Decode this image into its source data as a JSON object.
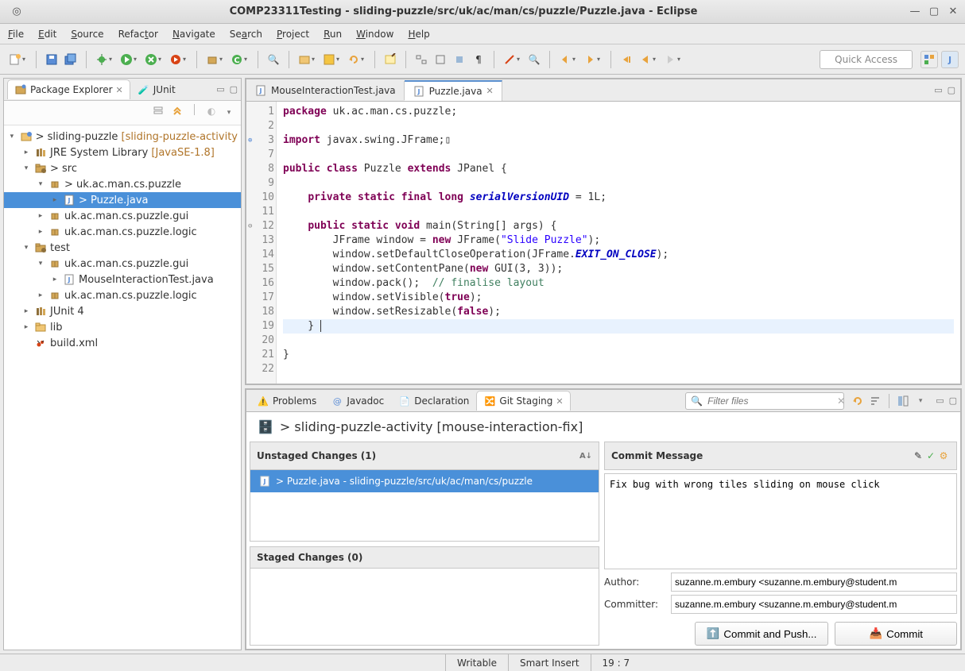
{
  "window": {
    "title": "COMP23311Testing - sliding-puzzle/src/uk/ac/man/cs/puzzle/Puzzle.java - Eclipse"
  },
  "menu": [
    "File",
    "Edit",
    "Source",
    "Refactor",
    "Navigate",
    "Search",
    "Project",
    "Run",
    "Window",
    "Help"
  ],
  "quick_access": "Quick Access",
  "left_view": {
    "tabs": [
      {
        "label": "Package Explorer",
        "active": true
      },
      {
        "label": "JUnit",
        "active": false
      }
    ],
    "tree": {
      "root": {
        "label": "sliding-puzzle",
        "decor": "[sliding-puzzle-activity",
        "prefix": ">"
      },
      "items": [
        {
          "indent": 1,
          "twisty": "▸",
          "icon": "library",
          "label": "JRE System Library",
          "decor": "[JavaSE-1.8]"
        },
        {
          "indent": 1,
          "twisty": "▾",
          "icon": "srcfolder",
          "label": "src",
          "prefix": ">"
        },
        {
          "indent": 2,
          "twisty": "▾",
          "icon": "package",
          "label": "uk.ac.man.cs.puzzle",
          "prefix": ">"
        },
        {
          "indent": 3,
          "twisty": "▸",
          "icon": "java",
          "label": "Puzzle.java",
          "prefix": ">",
          "selected": true
        },
        {
          "indent": 2,
          "twisty": "▸",
          "icon": "package",
          "label": "uk.ac.man.cs.puzzle.gui"
        },
        {
          "indent": 2,
          "twisty": "▸",
          "icon": "package",
          "label": "uk.ac.man.cs.puzzle.logic"
        },
        {
          "indent": 1,
          "twisty": "▾",
          "icon": "srcfolder",
          "label": "test"
        },
        {
          "indent": 2,
          "twisty": "▾",
          "icon": "package",
          "label": "uk.ac.man.cs.puzzle.gui"
        },
        {
          "indent": 3,
          "twisty": "▸",
          "icon": "java",
          "label": "MouseInteractionTest.java"
        },
        {
          "indent": 2,
          "twisty": "▸",
          "icon": "package",
          "label": "uk.ac.man.cs.puzzle.logic"
        },
        {
          "indent": 1,
          "twisty": "▸",
          "icon": "library",
          "label": "JUnit 4"
        },
        {
          "indent": 1,
          "twisty": "▸",
          "icon": "folder",
          "label": "lib"
        },
        {
          "indent": 1,
          "twisty": "",
          "icon": "ant",
          "label": "build.xml"
        }
      ]
    }
  },
  "editor": {
    "tabs": [
      {
        "label": "MouseInteractionTest.java",
        "active": false
      },
      {
        "label": "Puzzle.java",
        "active": true
      }
    ],
    "lines": [
      1,
      2,
      3,
      7,
      8,
      9,
      10,
      11,
      12,
      13,
      14,
      15,
      16,
      17,
      18,
      19,
      20,
      21,
      22
    ]
  },
  "bottom_view": {
    "tabs": [
      {
        "label": "Problems",
        "active": false
      },
      {
        "label": "Javadoc",
        "active": false
      },
      {
        "label": "Declaration",
        "active": false
      },
      {
        "label": "Git Staging",
        "active": true
      }
    ],
    "filter_placeholder": "Filter files",
    "repo_header": "> sliding-puzzle-activity [mouse-interaction-fix]",
    "unstaged_label": "Unstaged Changes (1)",
    "unstaged_file": "> Puzzle.java - sliding-puzzle/src/uk/ac/man/cs/puzzle",
    "staged_label": "Staged Changes (0)",
    "commit_label": "Commit Message",
    "commit_message": "Fix bug with wrong tiles sliding on mouse click",
    "author_label": "Author:",
    "committer_label": "Committer:",
    "author_value": "suzanne.m.embury <suzanne.m.embury@student.m",
    "committer_value": "suzanne.m.embury <suzanne.m.embury@student.m",
    "commit_push_btn": "Commit and Push...",
    "commit_btn": "Commit"
  },
  "status": {
    "writable": "Writable",
    "insert": "Smart Insert",
    "pos": "19 : 7"
  }
}
